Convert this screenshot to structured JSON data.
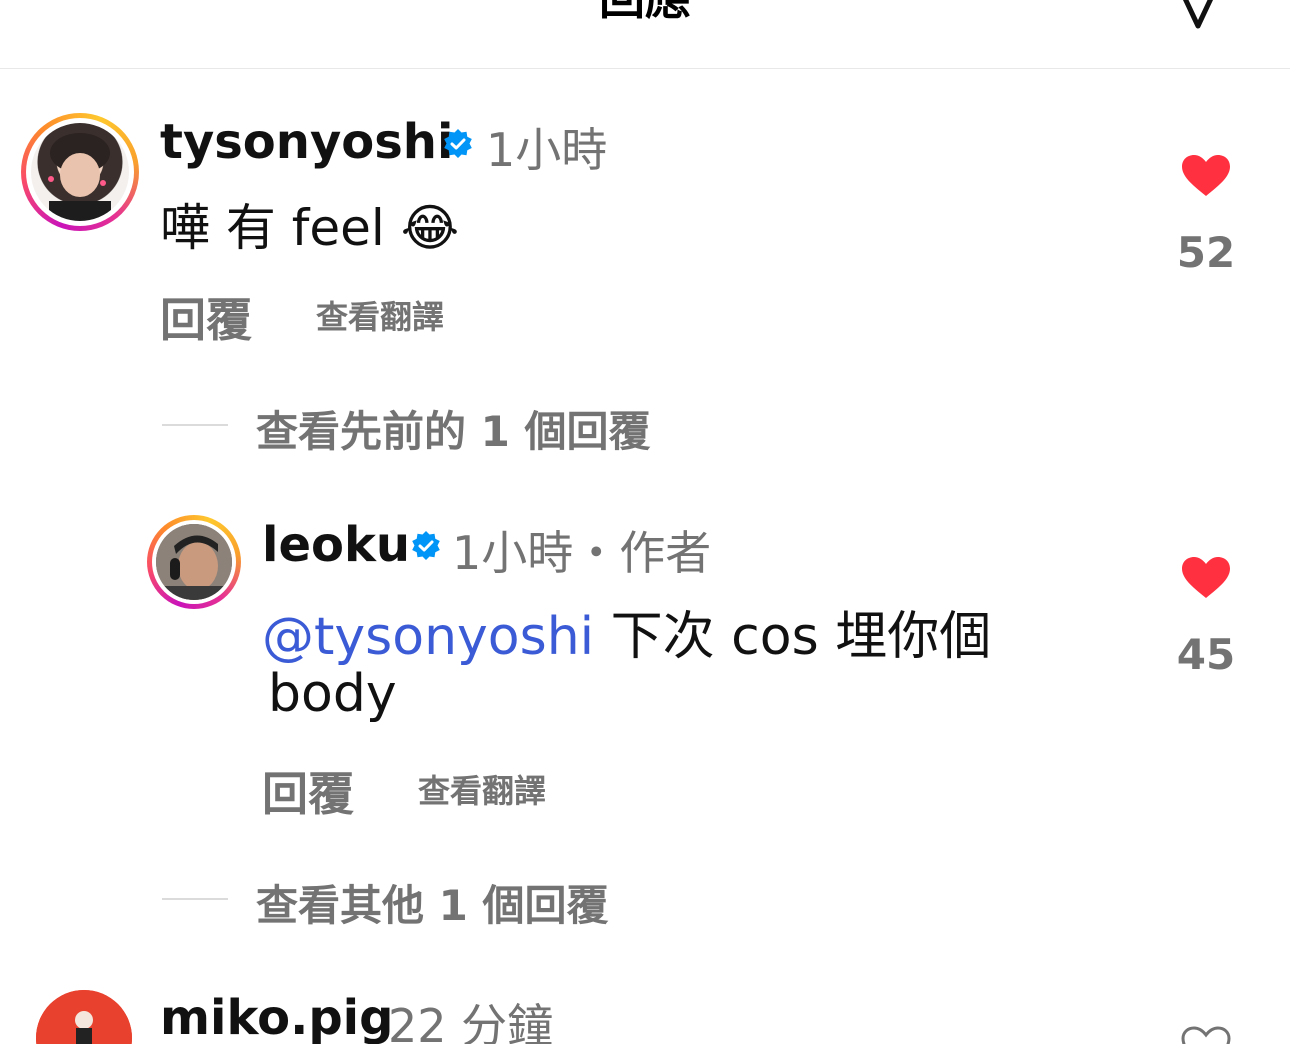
{
  "header": {
    "title": "回應",
    "icon": "chevron-down-icon"
  },
  "comments": [
    {
      "username": "tysonyoshi",
      "verified": true,
      "time": "1小時",
      "text": "嘩 有 feel 😂",
      "reply_label": "回覆",
      "translate_label": "查看翻譯",
      "likes": "52",
      "liked": true
    }
  ],
  "prev_replies_label": "查看先前的 1 個回覆",
  "reply": {
    "username": "leoku",
    "verified": true,
    "time": "1小時・作者",
    "mention": "@tysonyoshi",
    "text_line1": "下次 cos 埋你個",
    "text_line2": "body",
    "reply_label": "回覆",
    "translate_label": "查看翻譯",
    "likes": "45",
    "liked": true
  },
  "more_replies_label": "查看其他 1 個回覆",
  "next_comment": {
    "username": "miko.pig",
    "time": "22 分鐘"
  },
  "colors": {
    "like_red": "#ff3040",
    "verified_blue": "#0095f6",
    "mention_blue": "#3b5bd6",
    "secondary_gray": "#737373"
  }
}
